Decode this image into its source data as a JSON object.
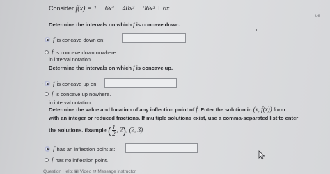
{
  "problem": {
    "prefix": "Consider ",
    "function": "f(x) = 1 − 6x⁴ − 40x³ − 96x² + 6x"
  },
  "section1": {
    "question_prefix": "Determine the intervals on which ",
    "question_var": "f",
    "question_suffix": " is concave down.",
    "option1_var": "f",
    "option1_text": " is concave down on:",
    "option2_var": "f",
    "option2_text": " is concave down nowhere.",
    "note": "in interval notation."
  },
  "section2": {
    "question_prefix": "Determine the intervals on which ",
    "question_var": "f",
    "question_suffix": " is concave up.",
    "option1_var": "f",
    "option1_text": " is concave up on:",
    "option2_var": "f",
    "option2_text": " is concave up nowhere.",
    "note": "in interval notation."
  },
  "section3": {
    "line1_prefix": "Determine the value and location of any inflection point of ",
    "line1_var": "f",
    "line1_mid": ". Enter the solution in ",
    "line1_point": "(x, f(x))",
    "line1_suffix": " form",
    "line2": "with an integer or reduced fractions. If multiple solutions exist, use a comma-separated list to enter",
    "line3_prefix": "the solutions. Example ",
    "ex_num": "1",
    "ex_den": "2",
    "ex_rest": ", 2",
    "ex_point2": ", (2, 3)",
    "option1_var": "f",
    "option1_text": " has an inflection point at:",
    "option2_var": "f",
    "option2_text": " has no inflection point."
  },
  "footer": {
    "help": "Question Help:  ▣ Video   ✉ Message instructor"
  },
  "sidebar": {
    "label": "ue"
  },
  "selected_options": {
    "section1": 1,
    "section2": 1,
    "section3": 1
  }
}
